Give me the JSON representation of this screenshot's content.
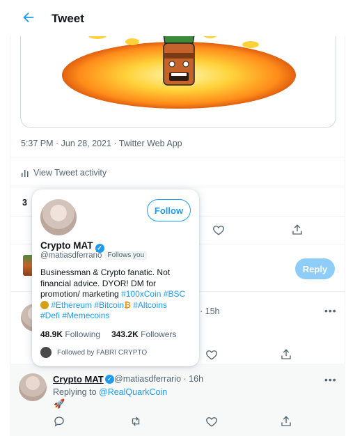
{
  "header": {
    "title": "Tweet"
  },
  "tweet": {
    "meta": "5:37 PM · Jun 28, 2021 · Twitter Web App",
    "activity_label": "View Tweet activity",
    "stat_count": "3"
  },
  "reply_button": "Reply",
  "reply1": {
    "time": "· 15h"
  },
  "hovercard": {
    "follow_label": "Follow",
    "name": "Crypto MAT",
    "handle": "@matiasdferrario",
    "follows_you": "Follows you",
    "bio_text": "Businessman & Crypto fanatic. Not financial advice. DYOR! DM for promotion/ marketing ",
    "tags_line1": [
      "#100xCoin",
      "#BSC"
    ],
    "tags_line2": [
      "#Ethereum",
      "#Bitcoin",
      "#Altcoins"
    ],
    "tags_line3": [
      "#Defi",
      "#Memecoins"
    ],
    "following_count": "48.9K",
    "following_label": "Following",
    "followers_count": "343.2K",
    "followers_label": "Followers",
    "followed_by": "Followed by FABRI CRYPTO"
  },
  "reply3": {
    "name": "Crypto MAT",
    "handle_time": "@matiasdferrario · 16h",
    "replying_prefix": "Replying to ",
    "replying_to": "@RealQuarkCoin",
    "content": "🚀"
  },
  "icons": [
    "back-arrow-icon",
    "bar-chart-icon",
    "comment-icon",
    "retweet-icon",
    "heart-icon",
    "share-icon",
    "more-icon",
    "verified-icon"
  ],
  "colors": {
    "accent": "#1d9bf0",
    "reply_disabled": "#8ecdf8",
    "secondary_text": "#536471"
  }
}
